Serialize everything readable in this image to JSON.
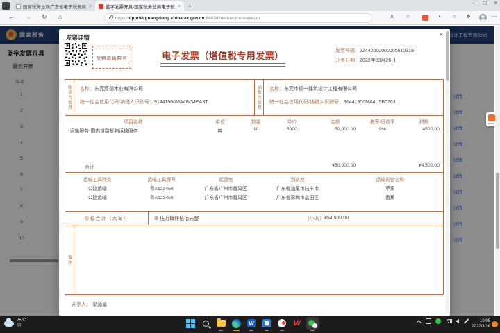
{
  "browser": {
    "tabs": [
      {
        "title": "国家税务总局广东省电子税务局"
      },
      {
        "title": "蓝字发票开具-国家税务总局电子税"
      }
    ],
    "tab_close": "×",
    "new_tab": "+",
    "window_controls": {
      "minimize": "–",
      "maximize": "□",
      "close": "×"
    },
    "nav": {
      "back": "←",
      "forward": "→",
      "refresh": "↻",
      "home": "⌂"
    },
    "url": {
      "scheme": "https://",
      "host": "dppt98.guangdong.chinatax.gov.cn",
      "path": ":8443/blue-invoice-makeout"
    },
    "actions": {
      "text_size": "A",
      "more": "⋯"
    }
  },
  "page": {
    "brand": "国家税务",
    "header_right": "设计工程有限公司",
    "sidebar_title": "蓝字发票开具",
    "recent_title": "最近开票",
    "seq_header": "序号",
    "row_numbers": [
      "1",
      "2",
      "3",
      "4",
      "5",
      "6",
      "7",
      "8",
      "9",
      "10"
    ],
    "detail_link": "详情"
  },
  "modal": {
    "title": "发票详情",
    "close": "×"
  },
  "invoice": {
    "service_tag": "货物运输服务",
    "title": "电子发票（增值税专用发票）",
    "number_label": "发票号码：",
    "number": "22442000000005610319",
    "date_label": "开票日期：",
    "date": "2022年03月26日",
    "buyer": {
      "side_label": "购买方信息",
      "name_label": "名称：",
      "name": "东莞宸德木业有限公司",
      "tax_label": "统一社会信用代码/纳税人识别号：",
      "tax_id": "91441900MA4W34EA3T"
    },
    "seller": {
      "side_label": "销售方信息",
      "name_label": "名称：",
      "name": "东莞市德一建筑设计工程有限公司",
      "tax_label": "统一社会信用代码/纳税人识别号：",
      "tax_id": "91441900MA4U5B076J"
    },
    "items": {
      "headers": [
        "项目名称",
        "单位",
        "数量",
        "单价",
        "金额",
        "税率/征收率",
        "税额"
      ],
      "rows": [
        [
          "*运输服务*国内道路货物运输服务",
          "吨",
          "10",
          "5000",
          "50,000.00",
          "9%",
          "4500.00"
        ]
      ],
      "total_label": "合计",
      "total_amount": "¥50,000.00",
      "total_tax": "¥4,500.00"
    },
    "transport": {
      "headers": [
        "运输工具种类",
        "运输工具牌号",
        "起运地",
        "到达地",
        "运输货物名称"
      ],
      "rows": [
        [
          "公路运输",
          "粤A123456",
          "广东省广州市番禺区",
          "广东省汕尾市陆丰市",
          "苹果"
        ],
        [
          "公路运输",
          "粤A123456",
          "广东省广州市番禺区",
          "广东省深圳市盐田区",
          "香蕉"
        ]
      ]
    },
    "total": {
      "label": "价税合计（大写）",
      "symbol": "⊗",
      "words": "伍万肆仟伍佰元整",
      "small_label": "（小写）",
      "small_value": "¥54,500.00"
    },
    "remark_label": "备注",
    "drawer_label": "开票人：",
    "drawer_name": "梁源昌"
  },
  "taskbar": {
    "weather_temp": "25°C",
    "weather_cond": "阴",
    "time": "10:05",
    "date": "2022/3/26"
  },
  "colors": {
    "invoice_border": "#b5714a",
    "invoice_title": "#a43a28",
    "header_blue": "#26417a",
    "link_blue": "#4b79d8"
  }
}
